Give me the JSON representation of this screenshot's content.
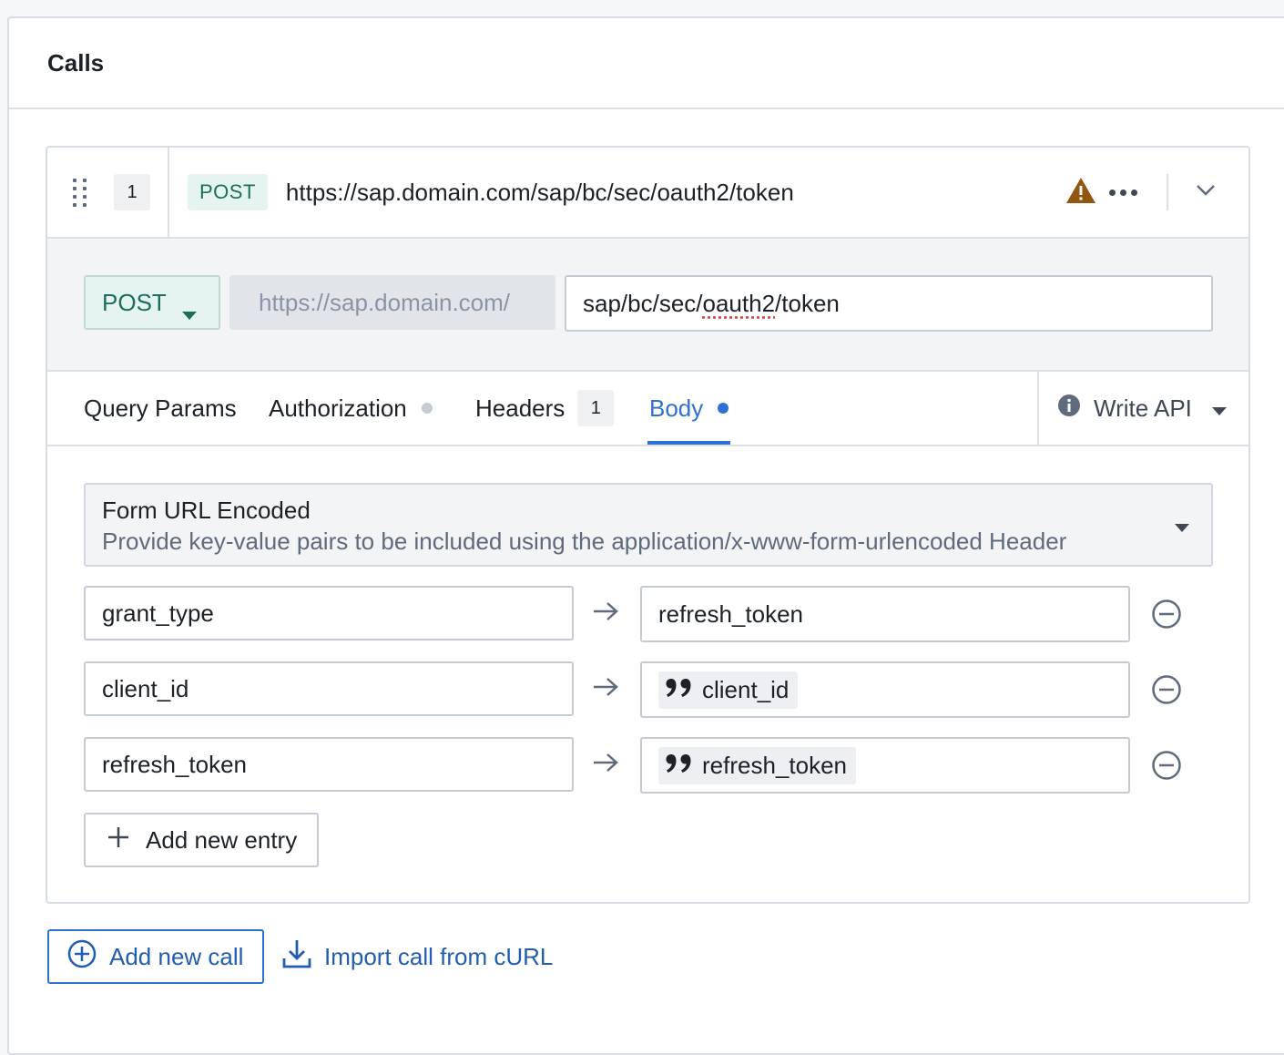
{
  "panel": {
    "title": "Calls"
  },
  "call": {
    "index": "1",
    "method": "POST",
    "url": "https://sap.domain.com/sap/bc/sec/oauth2/token",
    "icons": {
      "warning": "warning-icon",
      "more": "more-icon",
      "expand": "chevron-down-icon"
    }
  },
  "endpoint": {
    "method": "POST",
    "base_url": "https://sap.domain.com/",
    "path_prefix": "sap/bc/sec/",
    "path_flagged": "oauth2",
    "path_suffix": "/token"
  },
  "tabs": [
    {
      "label": "Query Params"
    },
    {
      "label": "Authorization"
    },
    {
      "label": "Headers",
      "count": "1"
    },
    {
      "label": "Body",
      "active": true
    }
  ],
  "write_api": {
    "label": "Write API"
  },
  "body": {
    "encoding_title": "Form URL Encoded",
    "encoding_description": "Provide key-value pairs to be included using the application/x-www-form-urlencoded Header",
    "entries": [
      {
        "key": "grant_type",
        "value": "refresh_token",
        "value_type": "literal"
      },
      {
        "key": "client_id",
        "value": "client_id",
        "value_type": "variable"
      },
      {
        "key": "refresh_token",
        "value": "refresh_token",
        "value_type": "variable"
      }
    ],
    "add_entry_label": "Add new entry"
  },
  "footer": {
    "add_call_label": "Add new call",
    "import_label": "Import call from cURL"
  },
  "colors": {
    "accent": "#2d72d2",
    "method": "#1c6e5c",
    "warning": "#935610"
  }
}
